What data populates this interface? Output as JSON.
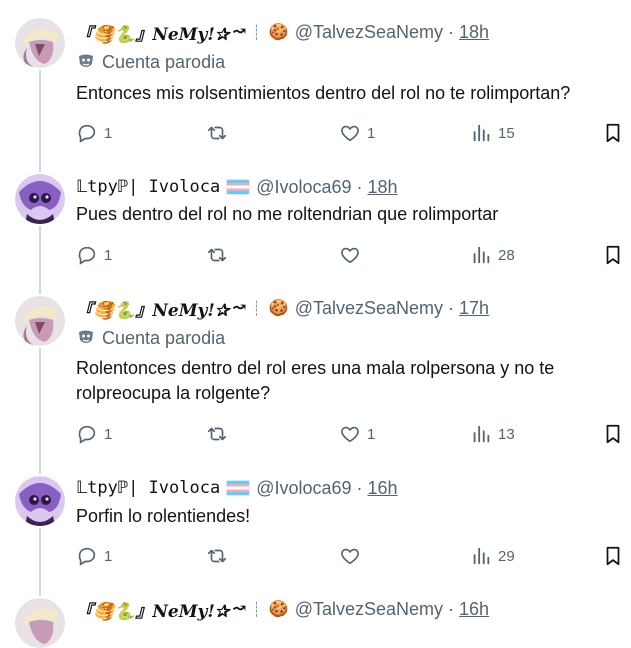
{
  "tweets": [
    {
      "display_name": "『🥞🐍』NeMy!✰",
      "name_suffix": "↝",
      "badge_emoji": "🍪",
      "handle": "@TalvezSeaNemy",
      "time": "18h",
      "parody_label": "Cuenta parodia",
      "text": "Entonces mis rolsentimientos dentro del rol no te rolimportan?",
      "replies": "1",
      "retweets": "",
      "likes": "1",
      "views": "15"
    },
    {
      "display_name": "𝕃tpyℙ| Ivoloca",
      "handle": "@Ivoloca69",
      "time": "18h",
      "text": "Pues dentro del rol no me roltendrian que rolimportar",
      "replies": "1",
      "retweets": "",
      "likes": "",
      "views": "28"
    },
    {
      "display_name": "『🥞🐍』NeMy!✰",
      "name_suffix": "↝",
      "badge_emoji": "🍪",
      "handle": "@TalvezSeaNemy",
      "time": "17h",
      "parody_label": "Cuenta parodia",
      "text": "Rolentonces dentro del rol eres una mala rolpersona y no te rolpreocupa la rolgente?",
      "replies": "1",
      "retweets": "",
      "likes": "1",
      "views": "13"
    },
    {
      "display_name": "𝕃tpyℙ| Ivoloca",
      "handle": "@Ivoloca69",
      "time": "16h",
      "text": "Porfin lo rolentiendes!",
      "replies": "1",
      "retweets": "",
      "likes": "",
      "views": "29"
    },
    {
      "display_name": "『🥞🐍』NeMy!✰",
      "name_suffix": "↝",
      "badge_emoji": "🍪",
      "handle": "@TalvezSeaNemy",
      "time": "16h"
    }
  ],
  "colors": {
    "text_primary": "#0f1419",
    "text_secondary": "#536471",
    "thread_line": "#cfd9de",
    "trans_flag": [
      "#5bcefa",
      "#f5a9b8",
      "#ffffff"
    ]
  },
  "icons": [
    "reply-icon",
    "retweet-icon",
    "like-icon",
    "views-icon",
    "bookmark-icon",
    "parody-mask-icon"
  ]
}
